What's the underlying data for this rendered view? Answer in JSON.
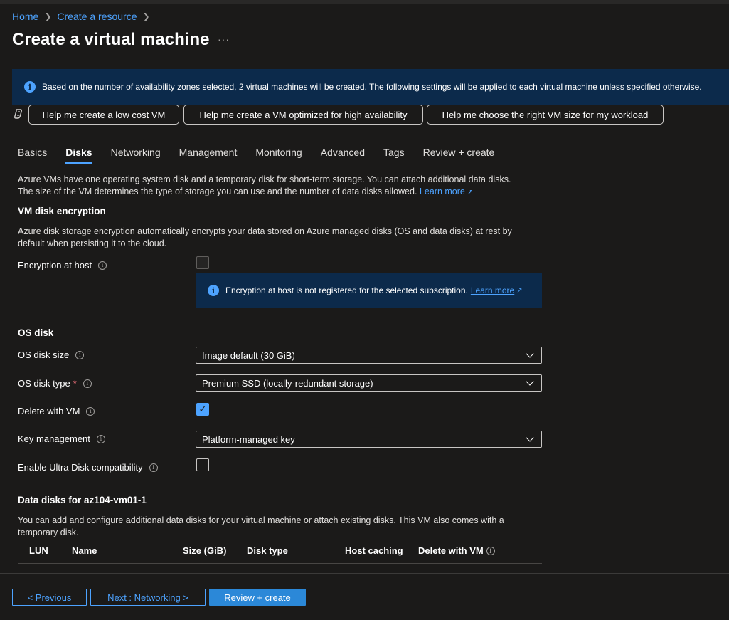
{
  "breadcrumb": {
    "home": "Home",
    "create_resource": "Create a resource"
  },
  "page": {
    "title": "Create a virtual machine",
    "more": "···"
  },
  "banner": {
    "text": "Based on the number of availability zones selected, 2 virtual machines will be created. The following settings will be applied to each virtual machine unless specified otherwise."
  },
  "help_buttons": [
    {
      "label": "Help me create a low cost VM"
    },
    {
      "label": "Help me create a VM optimized for high availability"
    },
    {
      "label": "Help me choose the right VM size for my workload"
    }
  ],
  "tabs": [
    {
      "label": "Basics"
    },
    {
      "label": "Disks",
      "active": true
    },
    {
      "label": "Networking"
    },
    {
      "label": "Management"
    },
    {
      "label": "Monitoring"
    },
    {
      "label": "Advanced"
    },
    {
      "label": "Tags"
    },
    {
      "label": "Review + create"
    }
  ],
  "intro": {
    "line1": "Azure VMs have one operating system disk and a temporary disk for short-term storage. You can attach additional data disks.",
    "line2": "The size of the VM determines the type of storage you can use and the number of data disks allowed.",
    "learn_more": "Learn more"
  },
  "encryption": {
    "heading": "VM disk encryption",
    "desc": "Azure disk storage encryption automatically encrypts your data stored on Azure managed disks (OS and data disks) at rest by default when persisting it to the cloud.",
    "host_label": "Encryption at host",
    "host_checked": false,
    "notice_text": "Encryption at host is not registered for the selected subscription.",
    "notice_link": "Learn more"
  },
  "os_disk": {
    "heading": "OS disk",
    "size_label": "OS disk size",
    "size_value": "Image default (30 GiB)",
    "type_label": "OS disk type",
    "required_mark": "*",
    "type_value": "Premium SSD (locally-redundant storage)",
    "delete_label": "Delete with VM",
    "delete_checked": true,
    "key_label": "Key management",
    "key_value": "Platform-managed key",
    "ultra_label": "Enable Ultra Disk compatibility",
    "ultra_checked": false
  },
  "data_disks": {
    "heading": "Data disks for az104-vm01-1",
    "desc": "You can add and configure additional data disks for your virtual machine or attach existing disks. This VM also comes with a temporary disk.",
    "columns": [
      "LUN",
      "Name",
      "Size (GiB)",
      "Disk type",
      "Host caching",
      "Delete with VM"
    ]
  },
  "footer": {
    "previous": "< Previous",
    "next": "Next : Networking >",
    "review": "Review + create"
  },
  "colors": {
    "accent": "#4da3ff",
    "banner_bg": "#0c2a4b",
    "page_bg": "#1b1a19",
    "primary_button": "#2b88d8"
  }
}
